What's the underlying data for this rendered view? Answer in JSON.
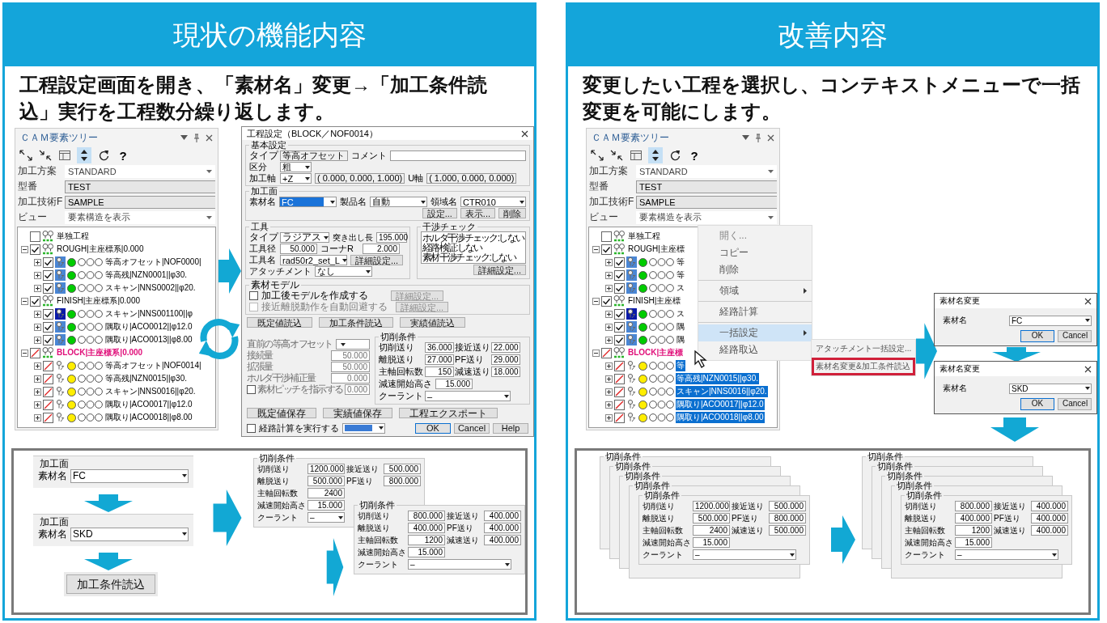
{
  "panels": [
    {
      "kind": "current",
      "title": "現状の機能内容",
      "headline": "工程設定画面を開き、「素材名」変更→「加工条件読込」実行を工程数分繰り返します。",
      "tree": {
        "title": "ＣＡＭ要素ツリー",
        "toolbar": [
          {
            "kind": "expand",
            "selected": false
          },
          {
            "kind": "collapse",
            "selected": false
          },
          {
            "kind": "table",
            "selected": false
          },
          {
            "kind": "sort",
            "selected": true
          },
          {
            "kind": "refresh",
            "selected": false
          },
          {
            "kind": "help",
            "label": "?",
            "selected": false
          }
        ],
        "fields": [
          {
            "kind": "dropdown",
            "label": "加工方案",
            "value": "STANDARD"
          },
          {
            "kind": "text",
            "label": "型番",
            "value": "TEST"
          },
          {
            "kind": "text",
            "label": "加工技術F",
            "value": "SAMPLE"
          },
          {
            "kind": "dropdown",
            "label": "ビュー",
            "value": "要素構造を表示"
          }
        ],
        "nodes": [
          {
            "kind": "group",
            "label": "単独工程",
            "checked": false,
            "excluded": false
          },
          {
            "kind": "group",
            "label": "ROUGH|主座標系|0.000",
            "checked": true,
            "excluded": false,
            "expanded": true,
            "children": [
              {
                "kind": "step",
                "label": "等高オフセット|NOF0000|",
                "checked": true,
                "excluded": false,
                "expanded": false,
                "highlighted": true,
                "current": false,
                "color": "#00cc00",
                "selected": false
              },
              {
                "kind": "step",
                "label": "等高残|NZN0001||φ30.",
                "checked": true,
                "excluded": false,
                "expanded": false,
                "highlighted": true,
                "current": false,
                "color": "#00cc00",
                "selected": false
              },
              {
                "kind": "step",
                "label": "スキャン|NNS0002||φ20.",
                "checked": true,
                "excluded": false,
                "expanded": false,
                "highlighted": true,
                "current": false,
                "color": "#00cc00",
                "selected": false
              }
            ]
          },
          {
            "kind": "group",
            "label": "FINISH|主座標系|0.000",
            "checked": true,
            "excluded": false,
            "expanded": true,
            "children": [
              {
                "kind": "step",
                "label": "スキャン|NNS001100||φ",
                "checked": true,
                "excluded": false,
                "expanded": false,
                "highlighted": true,
                "current": true,
                "color": "#00cc00",
                "selected": false
              },
              {
                "kind": "step",
                "label": "隅取り|ACO0012||φ12.0",
                "checked": true,
                "excluded": false,
                "expanded": false,
                "highlighted": true,
                "current": false,
                "color": "#00cc00",
                "selected": false
              },
              {
                "kind": "step",
                "label": "隅取り|ACO0013||φ8.00",
                "checked": true,
                "excluded": false,
                "expanded": false,
                "highlighted": true,
                "current": false,
                "color": "#00cc00",
                "selected": false
              }
            ]
          },
          {
            "kind": "group",
            "label": "BLOCK|主座標系|0.000",
            "checked": false,
            "excluded": true,
            "expanded": true,
            "children": [
              {
                "kind": "step",
                "label": "等高オフセット|NOF0014|",
                "checked": false,
                "excluded": true,
                "expanded": false,
                "highlighted": false,
                "current": false,
                "color": "#ffee00",
                "selected": false
              },
              {
                "kind": "step",
                "label": "等高残|NZN0015||φ30.",
                "checked": false,
                "excluded": true,
                "expanded": false,
                "highlighted": false,
                "current": false,
                "color": "#ffee00",
                "selected": false
              },
              {
                "kind": "step",
                "label": "スキャン|NNS0016||φ20.",
                "checked": false,
                "excluded": true,
                "expanded": false,
                "highlighted": false,
                "current": false,
                "color": "#ffee00",
                "selected": false
              },
              {
                "kind": "step",
                "label": "隅取り|ACO0017||φ12.0",
                "checked": false,
                "excluded": true,
                "expanded": false,
                "highlighted": false,
                "current": false,
                "color": "#ffee00",
                "selected": false
              },
              {
                "kind": "step",
                "label": "隅取り|ACO0018||φ8.00",
                "checked": false,
                "excluded": true,
                "expanded": false,
                "highlighted": false,
                "current": false,
                "color": "#ffee00",
                "selected": false
              }
            ]
          }
        ]
      },
      "dialog": {
        "title": "工程設定（BLOCK／NOF0014）",
        "basic": {
          "legend": "基本設定",
          "type_label": "タイプ",
          "type_value": "等高オフセット",
          "comment_label": "コメント",
          "class_label": "区分",
          "class_value": "粗",
          "axis_label": "加工軸",
          "axis_value": "+Z",
          "axis_vector": "( 0.000, 0.000, 1.000)",
          "u_label": "U軸",
          "u_vector": "( 1.000, 0.000, 0.000)"
        },
        "surface": {
          "legend": "加工面",
          "material_label": "素材名",
          "material_value": "FC",
          "material_focused": true,
          "product_label": "製品名",
          "product_value": "自動",
          "region_label": "領域名",
          "region_value": "CTR010",
          "buttons": [
            "設定...",
            "表示...",
            "削除"
          ]
        },
        "tool": {
          "legend": "工具",
          "type_label": "タイプ",
          "type_value": "ラジアス",
          "stickout_label": "突き出し長",
          "stickout_value": "195.000",
          "diameter_label": "工具径",
          "diameter_value": "50.000",
          "corner_label": "コーナR",
          "corner_value": "2.000",
          "name_label": "工具名",
          "name_value": "rad50r2_set_L",
          "detail_button": "詳細設定...",
          "attachment_label": "アタッチメント",
          "attachment_value": "なし"
        },
        "check": {
          "legend": "干渉チェック",
          "lines": [
            "ホルダ干渉チェック:しない",
            "経路検証:しない",
            "素材干渉チェック:しない"
          ],
          "button": "詳細設定..."
        },
        "model": {
          "legend": "素材モデル",
          "options": [
            {
              "label": "加工後モデルを作成する",
              "checked": false,
              "disabled": false,
              "button": "詳細設定..."
            },
            {
              "label": "接近離脱動作を自動回避する",
              "checked": false,
              "disabled": true,
              "button": "詳細設定..."
            }
          ]
        },
        "load_buttons": [
          "既定値読込",
          "加工条件読込",
          "実績値読込"
        ],
        "offset": {
          "disabled": true,
          "prev_label": "直前の等高オフセット",
          "rows": [
            {
              "label": "接続量",
              "value": "50.000"
            },
            {
              "label": "拡張量",
              "value": "50.000"
            },
            {
              "label": "ホルダ干渉補正量",
              "value": "0.000"
            }
          ],
          "pitch": {
            "label": "素材ピッチを指示する",
            "checked": false,
            "value": "0.000"
          }
        },
        "cutting": {
          "legend": "切削条件",
          "rows": [
            [
              {
                "label": "切削送り",
                "value": "36.000"
              },
              {
                "label": "接近送り",
                "value": "22.000"
              }
            ],
            [
              {
                "label": "離脱送り",
                "value": "27.000"
              },
              {
                "label": "PF送り",
                "value": "29.000"
              }
            ],
            [
              {
                "label": "主軸回転数",
                "value": "150"
              },
              {
                "label": "減速送り",
                "value": "18.000"
              }
            ],
            [
              {
                "label": "減速開始高さ",
                "value": "15.000"
              }
            ]
          ],
          "coolant": {
            "label": "クーラント",
            "value": "–"
          }
        },
        "save_buttons": [
          "既定値保存",
          "実績値保存",
          "工程エクスポート"
        ],
        "footer": {
          "calc_label": "経路計算を実行する",
          "calc_checked": false,
          "buttons": [
            "OK",
            "Cancel",
            "Help"
          ]
        }
      },
      "materials": [
        {
          "legend": "加工面",
          "label": "素材名",
          "value": "FC"
        },
        {
          "legend": "加工面",
          "label": "素材名",
          "value": "SKD"
        }
      ],
      "load_button": "加工条件読込",
      "conditions": [
        {
          "legend": "切削条件",
          "rows": [
            [
              {
                "label": "切削送り",
                "value": "1200.000"
              },
              {
                "label": "接近送り",
                "value": "500.000"
              }
            ],
            [
              {
                "label": "離脱送り",
                "value": "500.000"
              },
              {
                "label": "PF送り",
                "value": "800.000"
              }
            ],
            [
              {
                "label": "主軸回転数",
                "value": "2400"
              }
            ],
            [
              {
                "label": "減速開始高さ",
                "value": "15.000"
              }
            ]
          ],
          "coolant": {
            "label": "クーラント",
            "value": "–"
          }
        },
        {
          "legend": "切削条件",
          "rows": [
            [
              {
                "label": "切削送り",
                "value": "800.000"
              },
              {
                "label": "接近送り",
                "value": "400.000"
              }
            ],
            [
              {
                "label": "離脱送り",
                "value": "400.000"
              },
              {
                "label": "PF送り",
                "value": "400.000"
              }
            ],
            [
              {
                "label": "主軸回転数",
                "value": "1200"
              },
              {
                "label": "減速送り",
                "value": "400.000"
              }
            ],
            [
              {
                "label": "減速開始高さ",
                "value": "15.000"
              }
            ]
          ],
          "coolant": {
            "label": "クーラント",
            "value": "–"
          }
        }
      ]
    },
    {
      "kind": "improved",
      "title": "改善内容",
      "headline": "変更したい工程を選択し、コンテキストメニューで一括変更を可能にします。",
      "tree": {
        "title": "ＣＡＭ要素ツリー",
        "toolbar": [
          {
            "kind": "expand",
            "selected": false
          },
          {
            "kind": "collapse",
            "selected": false
          },
          {
            "kind": "table",
            "selected": false
          },
          {
            "kind": "sort",
            "selected": true
          },
          {
            "kind": "refresh",
            "selected": false
          },
          {
            "kind": "help",
            "label": "?",
            "selected": false
          }
        ],
        "fields": [
          {
            "kind": "dropdown",
            "label": "加工方案",
            "value": "STANDARD"
          },
          {
            "kind": "text",
            "label": "型番",
            "value": "TEST"
          },
          {
            "kind": "text",
            "label": "加工技術F",
            "value": "SAMPLE"
          },
          {
            "kind": "dropdown",
            "label": "ビュー",
            "value": "要素構造を表示"
          }
        ],
        "nodes": [
          {
            "kind": "group",
            "label": "単独工程",
            "checked": false,
            "excluded": false
          },
          {
            "kind": "group",
            "label": "ROUGH|主座標",
            "checked": true,
            "excluded": false,
            "expanded": true,
            "children": [
              {
                "kind": "step",
                "label": "等",
                "checked": true,
                "excluded": false,
                "expanded": false,
                "highlighted": true,
                "current": false,
                "color": "#00cc00",
                "selected": false
              },
              {
                "kind": "step",
                "label": "等",
                "checked": true,
                "excluded": false,
                "expanded": false,
                "highlighted": true,
                "current": false,
                "color": "#00cc00",
                "selected": false
              },
              {
                "kind": "step",
                "label": "ス",
                "checked": true,
                "excluded": false,
                "expanded": false,
                "highlighted": true,
                "current": false,
                "color": "#00cc00",
                "selected": false
              }
            ]
          },
          {
            "kind": "group",
            "label": "FINISH|主座標",
            "checked": true,
            "excluded": false,
            "expanded": true,
            "children": [
              {
                "kind": "step",
                "label": "ス",
                "checked": true,
                "excluded": false,
                "expanded": false,
                "highlighted": true,
                "current": true,
                "color": "#00cc00",
                "selected": false
              },
              {
                "kind": "step",
                "label": "隅",
                "checked": true,
                "excluded": false,
                "expanded": false,
                "highlighted": true,
                "current": false,
                "color": "#00cc00",
                "selected": false
              },
              {
                "kind": "step",
                "label": "隅",
                "checked": true,
                "excluded": false,
                "expanded": false,
                "highlighted": true,
                "current": false,
                "color": "#00cc00",
                "selected": false
              }
            ]
          },
          {
            "kind": "group",
            "label": "BLOCK|主座標",
            "checked": false,
            "excluded": true,
            "expanded": true,
            "children": [
              {
                "kind": "step",
                "label": "等",
                "checked": false,
                "excluded": true,
                "expanded": false,
                "highlighted": false,
                "current": false,
                "color": "#ffee00",
                "selected": true
              },
              {
                "kind": "step",
                "label": "等高残|NZN0015||φ30.",
                "checked": false,
                "excluded": true,
                "expanded": false,
                "highlighted": false,
                "current": false,
                "color": "#ffee00",
                "selected": true
              },
              {
                "kind": "step",
                "label": "スキャン|NNS0016||φ20.",
                "checked": false,
                "excluded": true,
                "expanded": false,
                "highlighted": false,
                "current": false,
                "color": "#ffee00",
                "selected": true
              },
              {
                "kind": "step",
                "label": "隅取り|ACO0017||φ12.0",
                "checked": false,
                "excluded": true,
                "expanded": false,
                "highlighted": false,
                "current": false,
                "color": "#ffee00",
                "selected": true
              },
              {
                "kind": "step",
                "label": "隅取り|ACO0018||φ8.00",
                "checked": false,
                "excluded": true,
                "expanded": false,
                "highlighted": false,
                "current": false,
                "color": "#ffee00",
                "selected": true
              }
            ]
          }
        ]
      },
      "menu": {
        "items": [
          {
            "kind": "item",
            "label": "開く...",
            "disabled": true,
            "highlighted": false,
            "submenu": false
          },
          {
            "kind": "item",
            "label": "コピー",
            "disabled": false,
            "highlighted": false,
            "submenu": false
          },
          {
            "kind": "item",
            "label": "削除",
            "disabled": false,
            "highlighted": false,
            "submenu": false
          },
          {
            "kind": "separator"
          },
          {
            "kind": "item",
            "label": "領域",
            "disabled": false,
            "highlighted": false,
            "submenu": true
          },
          {
            "kind": "separator"
          },
          {
            "kind": "item",
            "label": "経路計算",
            "disabled": false,
            "highlighted": false,
            "submenu": false
          },
          {
            "kind": "separator"
          },
          {
            "kind": "item",
            "label": "一括設定",
            "disabled": false,
            "highlighted": true,
            "submenu": true
          },
          {
            "kind": "item",
            "label": "経路取込",
            "disabled": false,
            "highlighted": false,
            "submenu": false
          }
        ]
      },
      "submenu": {
        "items": [
          {
            "label": "アタッチメント一括設定...",
            "marked": false
          },
          {
            "label": "素材名変更&加工条件読込",
            "marked": true
          }
        ]
      },
      "dialogs": [
        {
          "title": "素材名変更",
          "label": "素材名",
          "value": "FC",
          "buttons": [
            {
              "label": "OK",
              "default": true
            },
            {
              "label": "Cancel",
              "default": false
            }
          ]
        },
        {
          "title": "素材名変更",
          "label": "素材名",
          "value": "SKD",
          "buttons": [
            {
              "label": "OK",
              "default": true
            },
            {
              "label": "Cancel",
              "default": false
            }
          ]
        }
      ],
      "stacks": [
        {
          "back_titles": [
            "切削条件",
            "切削条件",
            "切削条件",
            "切削条件"
          ],
          "front": {
            "legend": "切削条件",
            "rows": [
              [
                {
                  "label": "切削送り",
                  "value": "1200.000"
                },
                {
                  "label": "接近送り",
                  "value": "500.000"
                }
              ],
              [
                {
                  "label": "離脱送り",
                  "value": "500.000"
                },
                {
                  "label": "PF送り",
                  "value": "800.000"
                }
              ],
              [
                {
                  "label": "主軸回転数",
                  "value": "2400"
                },
                {
                  "label": "減速送り",
                  "value": "500.000"
                }
              ],
              [
                {
                  "label": "減速開始高さ",
                  "value": "15.000"
                }
              ]
            ],
            "coolant": {
              "label": "クーラント",
              "value": "–"
            }
          }
        },
        {
          "back_titles": [
            "切削条件",
            "切削条件",
            "切削条件",
            "切削条件"
          ],
          "front": {
            "legend": "切削条件",
            "rows": [
              [
                {
                  "label": "切削送り",
                  "value": "800.000"
                },
                {
                  "label": "接近送り",
                  "value": "400.000"
                }
              ],
              [
                {
                  "label": "離脱送り",
                  "value": "400.000"
                },
                {
                  "label": "PF送り",
                  "value": "400.000"
                }
              ],
              [
                {
                  "label": "主軸回転数",
                  "value": "1200"
                },
                {
                  "label": "減速送り",
                  "value": "400.000"
                }
              ],
              [
                {
                  "label": "減速開始高さ",
                  "value": "15.000"
                }
              ]
            ],
            "coolant": {
              "label": "クーラント",
              "value": "–"
            }
          }
        }
      ]
    }
  ]
}
